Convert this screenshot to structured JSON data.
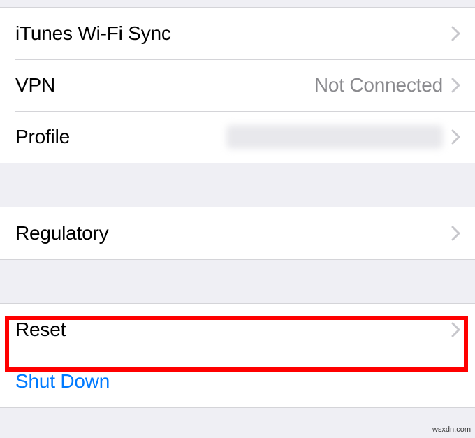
{
  "group1": {
    "itunes_wifi_sync": {
      "label": "iTunes Wi-Fi Sync"
    },
    "vpn": {
      "label": "VPN",
      "value": "Not Connected"
    },
    "profile": {
      "label": "Profile"
    }
  },
  "group2": {
    "regulatory": {
      "label": "Regulatory"
    }
  },
  "group3": {
    "reset": {
      "label": "Reset"
    },
    "shutdown": {
      "label": "Shut Down"
    }
  },
  "watermark": "wsxdn.com"
}
